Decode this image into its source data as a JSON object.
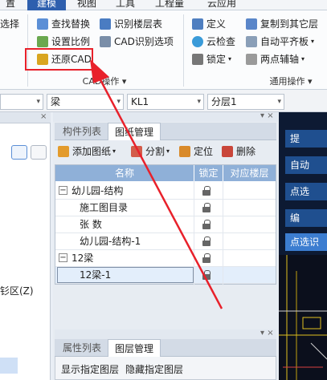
{
  "menu": [
    "置",
    "建模",
    "视图",
    "工具",
    "工程量",
    "云应用"
  ],
  "ribbon": {
    "left_cut": "选择",
    "col1": [
      "查找替换",
      "设置比例",
      "还原CAD"
    ],
    "col2": [
      "识别楼层表",
      "CAD识别选项"
    ],
    "group1_label": "CAD操作",
    "col3": [
      "定义",
      "云检查",
      "锁定"
    ],
    "col4": [
      "复制到其它层",
      "自动平齐板",
      "两点辅轴"
    ],
    "group2_label": "通用操作"
  },
  "toolbar": {
    "combo1": "",
    "combo2": "梁",
    "combo3": "KL1",
    "combo4": "分层1"
  },
  "left": {
    "cut_text": "钐区(Z)"
  },
  "panel": {
    "tabs": [
      "构件列表",
      "图纸管理"
    ],
    "actions": {
      "add": "添加图纸",
      "split": "分割",
      "locate": "定位",
      "delete": "删除"
    },
    "headers": [
      "名称",
      "锁定",
      "对应楼层"
    ],
    "rows": [
      {
        "label": "幼儿园-结构",
        "indent": 0,
        "toggle": "−"
      },
      {
        "label": "施工图目录",
        "indent": 1,
        "toggle": ""
      },
      {
        "label": "张 数",
        "indent": 1,
        "toggle": ""
      },
      {
        "label": "幼儿园-结构-1",
        "indent": 1,
        "toggle": ""
      },
      {
        "label": "12梁",
        "indent": 0,
        "toggle": "−"
      },
      {
        "label": "12梁-1",
        "indent": 1,
        "toggle": "",
        "selected": true
      }
    ]
  },
  "bottom_panel": {
    "tabs": [
      "属性列表",
      "图层管理"
    ],
    "options": [
      "显示指定图层",
      "隐藏指定图层"
    ]
  },
  "right_buttons": [
    "提",
    "自动",
    "点选",
    "编",
    "点选识"
  ],
  "accent_colors": {
    "highlight_red": "#e8212b",
    "menu_blue": "#2e5fae",
    "header_blue": "#8fb0d8"
  }
}
